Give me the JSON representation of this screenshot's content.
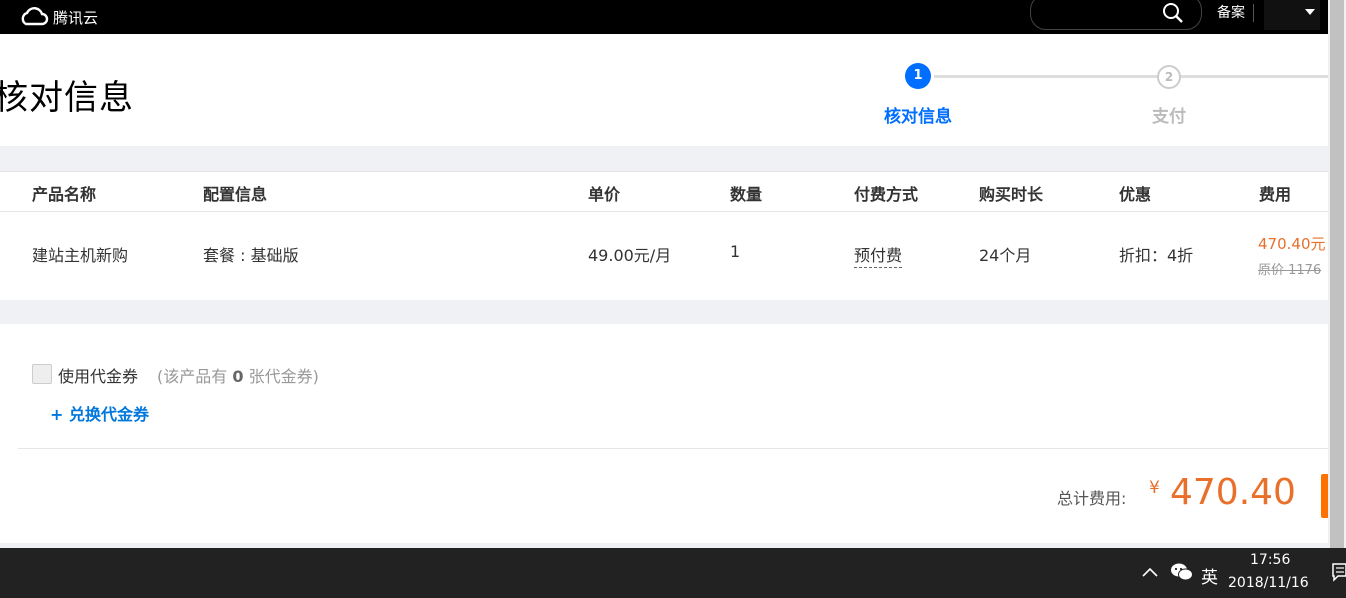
{
  "topbar": {
    "brand": "腾讯云",
    "search_placeholder": "",
    "beian": "备案"
  },
  "header": {
    "title": "核对信息",
    "steps": [
      {
        "number": "1",
        "label": "核对信息"
      },
      {
        "number": "2",
        "label": "支付"
      }
    ]
  },
  "table": {
    "columns": [
      "产品名称",
      "配置信息",
      "单价",
      "数量",
      "付费方式",
      "购买时长",
      "优惠",
      "费用"
    ],
    "row": {
      "product": "建站主机新购",
      "config": "套餐 : 基础版",
      "unit_price": "49.00元/月",
      "quantity": "1",
      "payment": "预付费",
      "duration": "24个月",
      "discount": "折扣：4折",
      "fee": "470.40元",
      "original": "原价 1176"
    }
  },
  "voucher": {
    "label": "使用代金券",
    "note_prefix": "(该产品有",
    "note_count": "0",
    "note_suffix": "张代金券)",
    "exchange": "+ 兑换代金券"
  },
  "total": {
    "label": "总计费用:",
    "currency": "¥",
    "amount": "470.40"
  },
  "taskbar": {
    "ime": "英",
    "time": "17:56",
    "date": "2018/11/16"
  },
  "colors": {
    "accent": "#006eff",
    "price": "#e8702a",
    "link": "#0077dd"
  }
}
